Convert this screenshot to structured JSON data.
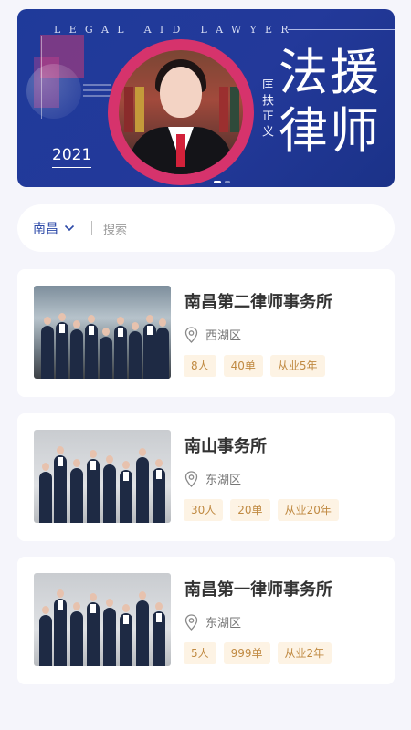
{
  "banner": {
    "top_text": "LEGAL AID LAWYER",
    "year": "2021",
    "vertical_text": "匡扶正义",
    "title_line1": "法援",
    "title_line2": "律师"
  },
  "search": {
    "city": "南昌",
    "placeholder": "搜索"
  },
  "firms": [
    {
      "name": "南昌第二律师事务所",
      "district": "西湖区",
      "tags": [
        "8人",
        "40单",
        "从业5年"
      ]
    },
    {
      "name": "南山事务所",
      "district": "东湖区",
      "tags": [
        "30人",
        "20单",
        "从业20年"
      ]
    },
    {
      "name": "南昌第一律师事务所",
      "district": "东湖区",
      "tags": [
        "5人",
        "999单",
        "从业2年"
      ]
    }
  ],
  "colors": {
    "banner_blue": "#23399a",
    "accent_blue": "#2d4aa8",
    "ring_pink": "#d6336c",
    "tag_bg": "#fdf3e4",
    "tag_text": "#c08a42"
  },
  "icons": {
    "city_dropdown": "chevron-down-icon",
    "location": "location-pin-icon"
  }
}
